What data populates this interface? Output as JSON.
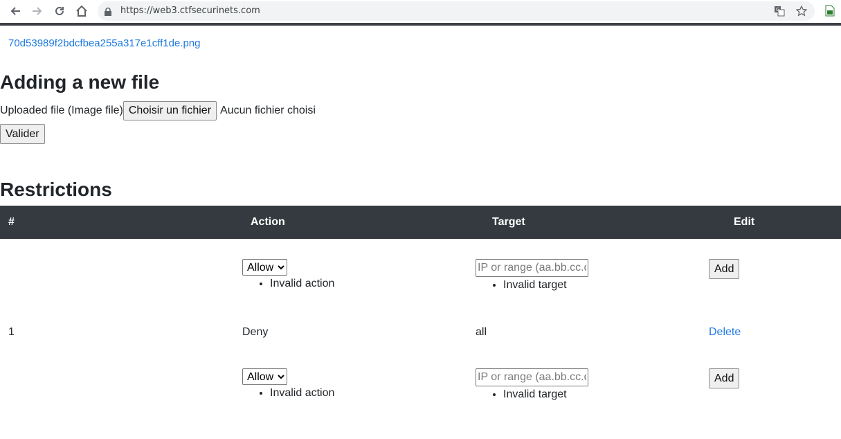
{
  "browser": {
    "url": "https://web3.ctfsecurinets.com"
  },
  "page": {
    "file_link": "70d53989f2bdcfbea255a317e1cff1de.png",
    "add_heading": "Adding a new file",
    "upload_label": "Uploaded file (Image file)",
    "choose_button": "Choisir un fichier",
    "no_file": "Aucun fichier choisi",
    "submit_button": "Valider",
    "restrictions_heading": "Restrictions"
  },
  "table": {
    "headers": [
      "#",
      "Action",
      "Target",
      "Edit"
    ],
    "form_row": {
      "action_value": "Allow",
      "action_error": "Invalid action",
      "target_placeholder": "IP or range (aa.bb.cc.dd",
      "target_error": "Invalid target",
      "add_button": "Add"
    },
    "rows": [
      {
        "num": "1",
        "action": "Deny",
        "target": "all",
        "edit": "Delete"
      }
    ]
  },
  "colors": {
    "link": "#1f7ae0",
    "header_bg": "#343a40"
  }
}
